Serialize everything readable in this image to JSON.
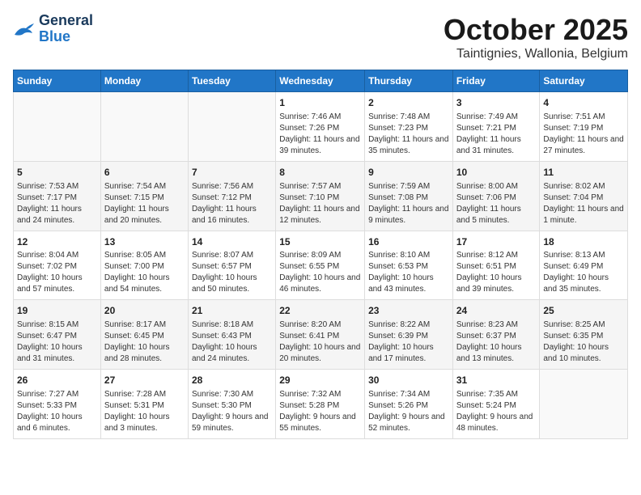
{
  "header": {
    "logo_line1": "General",
    "logo_line2": "Blue",
    "month": "October 2025",
    "subtitle": "Taintignies, Wallonia, Belgium"
  },
  "days_of_week": [
    "Sunday",
    "Monday",
    "Tuesday",
    "Wednesday",
    "Thursday",
    "Friday",
    "Saturday"
  ],
  "weeks": [
    [
      {
        "day": "",
        "text": ""
      },
      {
        "day": "",
        "text": ""
      },
      {
        "day": "",
        "text": ""
      },
      {
        "day": "1",
        "text": "Sunrise: 7:46 AM\nSunset: 7:26 PM\nDaylight: 11 hours and 39 minutes."
      },
      {
        "day": "2",
        "text": "Sunrise: 7:48 AM\nSunset: 7:23 PM\nDaylight: 11 hours and 35 minutes."
      },
      {
        "day": "3",
        "text": "Sunrise: 7:49 AM\nSunset: 7:21 PM\nDaylight: 11 hours and 31 minutes."
      },
      {
        "day": "4",
        "text": "Sunrise: 7:51 AM\nSunset: 7:19 PM\nDaylight: 11 hours and 27 minutes."
      }
    ],
    [
      {
        "day": "5",
        "text": "Sunrise: 7:53 AM\nSunset: 7:17 PM\nDaylight: 11 hours and 24 minutes."
      },
      {
        "day": "6",
        "text": "Sunrise: 7:54 AM\nSunset: 7:15 PM\nDaylight: 11 hours and 20 minutes."
      },
      {
        "day": "7",
        "text": "Sunrise: 7:56 AM\nSunset: 7:12 PM\nDaylight: 11 hours and 16 minutes."
      },
      {
        "day": "8",
        "text": "Sunrise: 7:57 AM\nSunset: 7:10 PM\nDaylight: 11 hours and 12 minutes."
      },
      {
        "day": "9",
        "text": "Sunrise: 7:59 AM\nSunset: 7:08 PM\nDaylight: 11 hours and 9 minutes."
      },
      {
        "day": "10",
        "text": "Sunrise: 8:00 AM\nSunset: 7:06 PM\nDaylight: 11 hours and 5 minutes."
      },
      {
        "day": "11",
        "text": "Sunrise: 8:02 AM\nSunset: 7:04 PM\nDaylight: 11 hours and 1 minute."
      }
    ],
    [
      {
        "day": "12",
        "text": "Sunrise: 8:04 AM\nSunset: 7:02 PM\nDaylight: 10 hours and 57 minutes."
      },
      {
        "day": "13",
        "text": "Sunrise: 8:05 AM\nSunset: 7:00 PM\nDaylight: 10 hours and 54 minutes."
      },
      {
        "day": "14",
        "text": "Sunrise: 8:07 AM\nSunset: 6:57 PM\nDaylight: 10 hours and 50 minutes."
      },
      {
        "day": "15",
        "text": "Sunrise: 8:09 AM\nSunset: 6:55 PM\nDaylight: 10 hours and 46 minutes."
      },
      {
        "day": "16",
        "text": "Sunrise: 8:10 AM\nSunset: 6:53 PM\nDaylight: 10 hours and 43 minutes."
      },
      {
        "day": "17",
        "text": "Sunrise: 8:12 AM\nSunset: 6:51 PM\nDaylight: 10 hours and 39 minutes."
      },
      {
        "day": "18",
        "text": "Sunrise: 8:13 AM\nSunset: 6:49 PM\nDaylight: 10 hours and 35 minutes."
      }
    ],
    [
      {
        "day": "19",
        "text": "Sunrise: 8:15 AM\nSunset: 6:47 PM\nDaylight: 10 hours and 31 minutes."
      },
      {
        "day": "20",
        "text": "Sunrise: 8:17 AM\nSunset: 6:45 PM\nDaylight: 10 hours and 28 minutes."
      },
      {
        "day": "21",
        "text": "Sunrise: 8:18 AM\nSunset: 6:43 PM\nDaylight: 10 hours and 24 minutes."
      },
      {
        "day": "22",
        "text": "Sunrise: 8:20 AM\nSunset: 6:41 PM\nDaylight: 10 hours and 20 minutes."
      },
      {
        "day": "23",
        "text": "Sunrise: 8:22 AM\nSunset: 6:39 PM\nDaylight: 10 hours and 17 minutes."
      },
      {
        "day": "24",
        "text": "Sunrise: 8:23 AM\nSunset: 6:37 PM\nDaylight: 10 hours and 13 minutes."
      },
      {
        "day": "25",
        "text": "Sunrise: 8:25 AM\nSunset: 6:35 PM\nDaylight: 10 hours and 10 minutes."
      }
    ],
    [
      {
        "day": "26",
        "text": "Sunrise: 7:27 AM\nSunset: 5:33 PM\nDaylight: 10 hours and 6 minutes."
      },
      {
        "day": "27",
        "text": "Sunrise: 7:28 AM\nSunset: 5:31 PM\nDaylight: 10 hours and 3 minutes."
      },
      {
        "day": "28",
        "text": "Sunrise: 7:30 AM\nSunset: 5:30 PM\nDaylight: 9 hours and 59 minutes."
      },
      {
        "day": "29",
        "text": "Sunrise: 7:32 AM\nSunset: 5:28 PM\nDaylight: 9 hours and 55 minutes."
      },
      {
        "day": "30",
        "text": "Sunrise: 7:34 AM\nSunset: 5:26 PM\nDaylight: 9 hours and 52 minutes."
      },
      {
        "day": "31",
        "text": "Sunrise: 7:35 AM\nSunset: 5:24 PM\nDaylight: 9 hours and 48 minutes."
      },
      {
        "day": "",
        "text": ""
      }
    ]
  ]
}
